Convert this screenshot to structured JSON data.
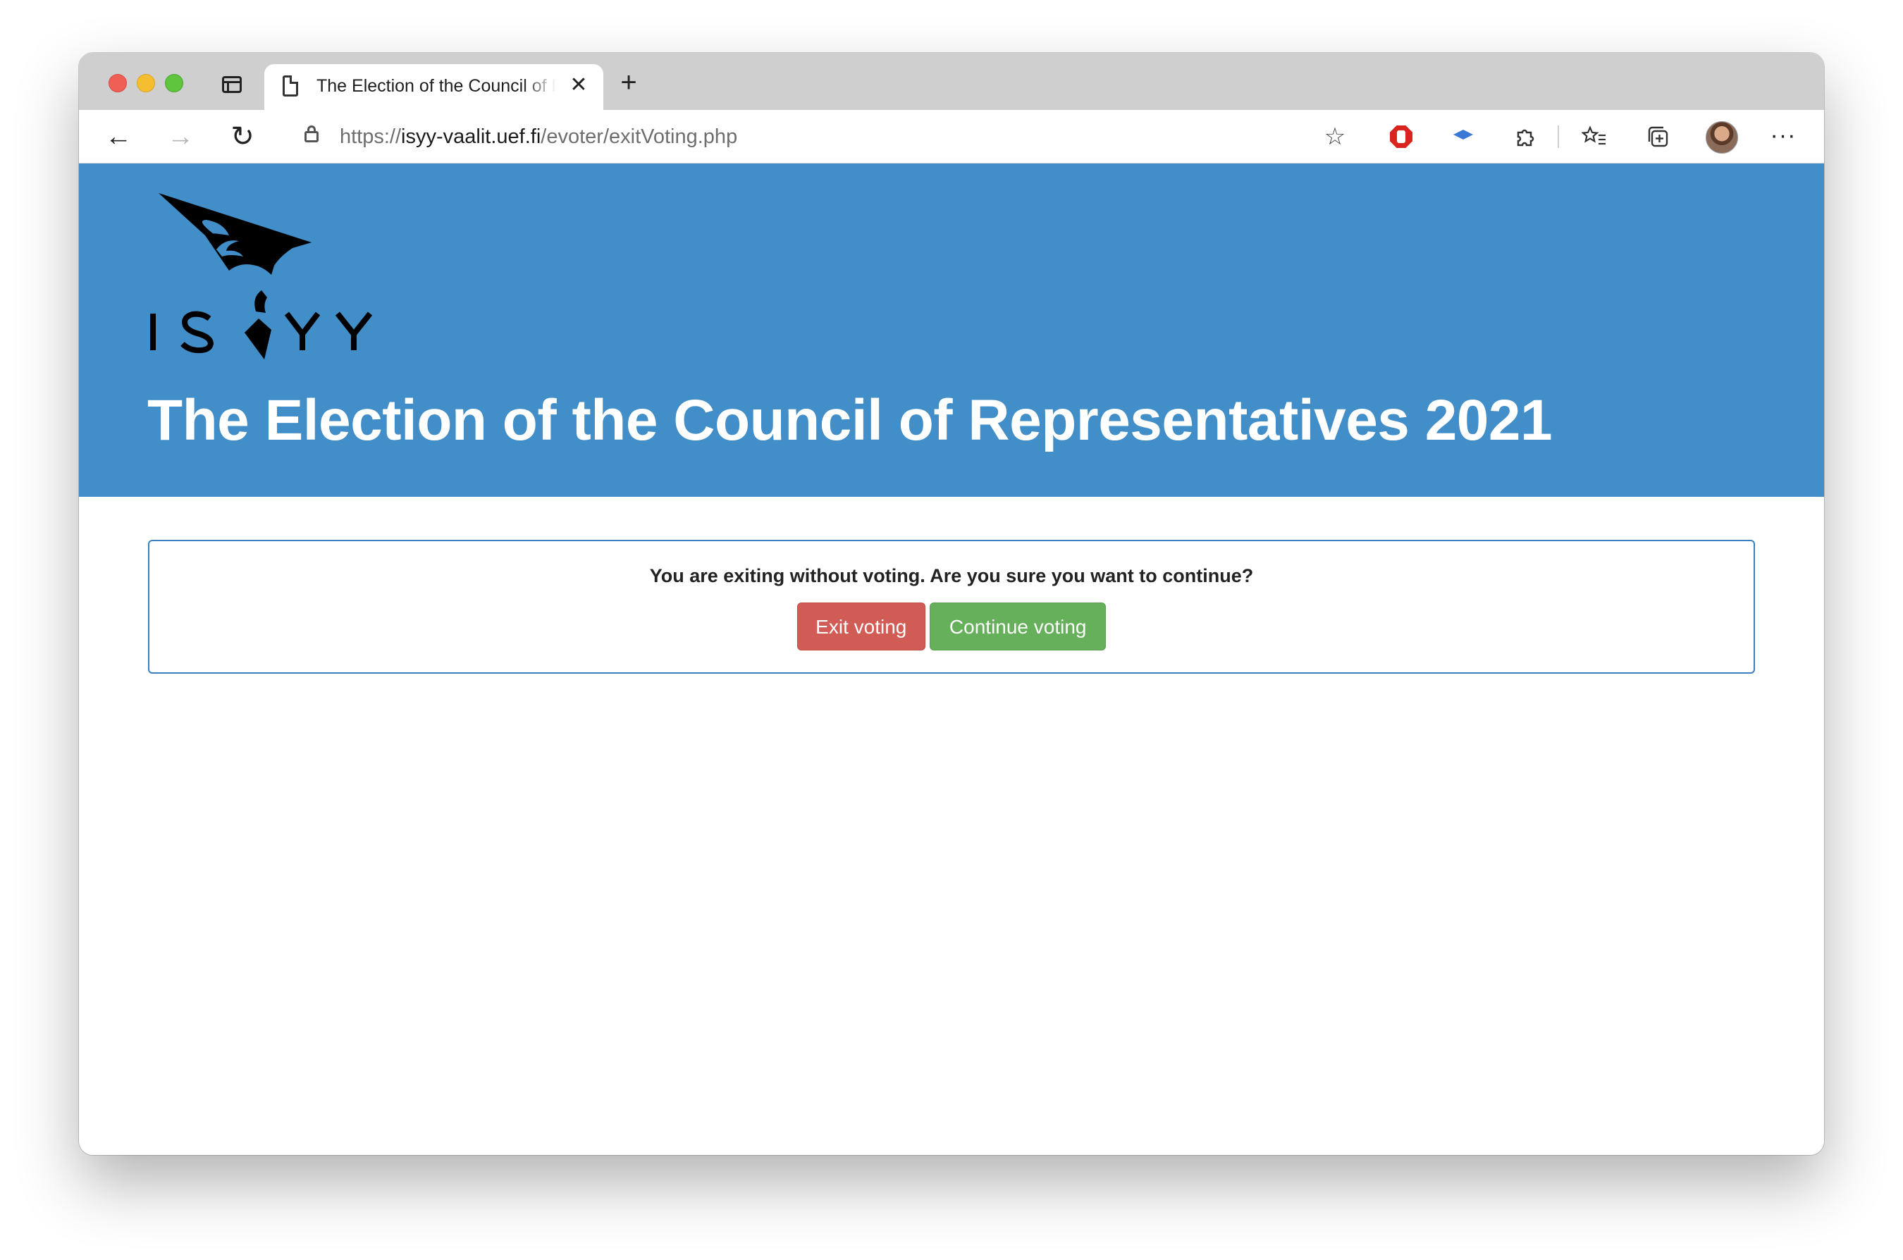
{
  "browser": {
    "tab": {
      "title": "The Election of the Council of Representatives 2021",
      "close_symbol": "✕"
    },
    "new_tab_symbol": "+",
    "nav": {
      "back_symbol": "←",
      "forward_symbol": "→",
      "reload_symbol": "↻"
    },
    "address": {
      "scheme": "https://",
      "host": "isyy-vaalit.uef.fi",
      "path": "/evoter/exitVoting.php"
    },
    "toolbar_icons": [
      "favorite-add-icon",
      "adblock-icon",
      "extension-cap-icon",
      "extensions-icon",
      "favorites-icon",
      "collections-icon",
      "profile-avatar",
      "more-icon"
    ]
  },
  "page": {
    "logo": "ISYY",
    "title": "The Election of the Council of Representatives 2021",
    "confirm": {
      "message": "You are exiting without voting. Are you sure you want to continue?",
      "exit_label": "Exit voting",
      "continue_label": "Continue voting"
    }
  },
  "colors": {
    "header_bg": "#418ec8",
    "exit_button": "#d15b55",
    "continue_button": "#66b05b",
    "box_border": "#3b7fc2"
  }
}
